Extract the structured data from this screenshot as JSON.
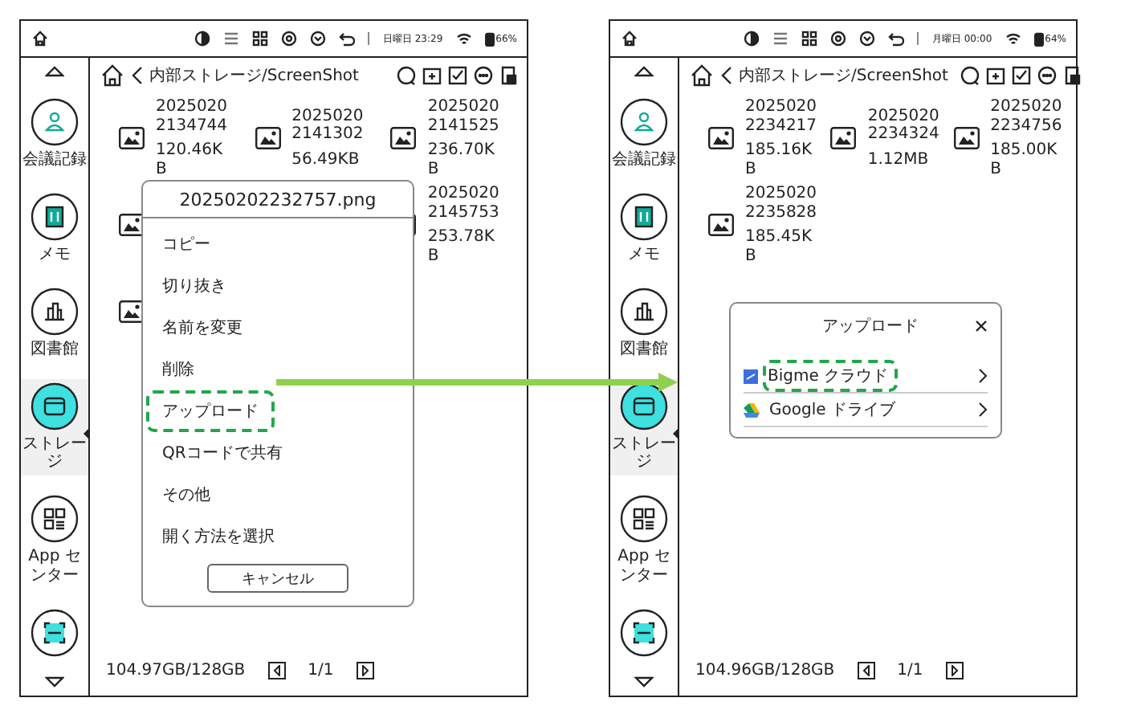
{
  "screens": [
    {
      "status_bar": {
        "day_time": "日曜日 23:29",
        "battery": "66%"
      },
      "sidebar": {
        "items": [
          {
            "kind": "meeting",
            "label": "会議記録",
            "selected": false
          },
          {
            "kind": "memo",
            "label": "メモ",
            "selected": false
          },
          {
            "kind": "library",
            "label": "図書館",
            "selected": false
          },
          {
            "kind": "storage",
            "label": "ストレージ",
            "selected": true
          },
          {
            "kind": "apps",
            "label": "App センター",
            "selected": false
          },
          {
            "kind": "scan",
            "selected": false
          }
        ]
      },
      "path": "内部ストレージ/ScreenShot",
      "files": [
        {
          "kind": "file",
          "name": "20250202134744",
          "size": "120.46KB"
        },
        {
          "kind": "file",
          "name": "20250202141302",
          "size": "56.49KB"
        },
        {
          "kind": "file",
          "name": "20250202141525",
          "size": "236.70KB"
        },
        {
          "kind": "covered"
        },
        {
          "kind": "covered"
        },
        {
          "kind": "file",
          "name": "20250202145753",
          "size": "253.78KB"
        },
        {
          "kind": "covered"
        }
      ],
      "storage": "104.97GB/128GB",
      "page": "1/1",
      "menu": {
        "title": "20250202232757.png",
        "items": [
          {
            "label": "コピー",
            "highlighted": false
          },
          {
            "label": "切り抜き",
            "highlighted": false
          },
          {
            "label": "名前を変更",
            "highlighted": false
          },
          {
            "label": "削除",
            "highlighted": false
          },
          {
            "label": "アップロード",
            "highlighted": true
          },
          {
            "label": "QRコードで共有",
            "highlighted": false
          },
          {
            "label": "その他",
            "highlighted": false
          },
          {
            "label": "開く方法を選択",
            "highlighted": false
          }
        ],
        "cancel": "キャンセル"
      }
    },
    {
      "status_bar": {
        "day_time": "月曜日 00:00",
        "battery": "64%"
      },
      "sidebar": {
        "items": [
          {
            "kind": "meeting",
            "label": "会議記録",
            "selected": false
          },
          {
            "kind": "memo",
            "label": "メモ",
            "selected": false
          },
          {
            "kind": "library",
            "label": "図書館",
            "selected": false
          },
          {
            "kind": "storage",
            "label": "ストレージ",
            "selected": true
          },
          {
            "kind": "apps",
            "label": "App センター",
            "selected": false
          },
          {
            "kind": "scan",
            "selected": false
          }
        ]
      },
      "path": "内部ストレージ/ScreenShot",
      "files": [
        {
          "kind": "file",
          "name": "20250202234217",
          "size": "185.16KB"
        },
        {
          "kind": "file",
          "name": "20250202234324",
          "size": "1.12MB"
        },
        {
          "kind": "file",
          "name": "20250202234756",
          "size": "185.00KB"
        },
        {
          "kind": "file",
          "name": "20250202235828",
          "size": "185.45KB"
        }
      ],
      "storage": "104.96GB/128GB",
      "page": "1/1",
      "dialog": {
        "title": "アップロード",
        "items": [
          {
            "kind": "bigme",
            "label": "Bigme クラウド",
            "highlighted": true
          },
          {
            "kind": "gdrive",
            "label": "Google ドライブ",
            "highlighted": false
          }
        ]
      }
    }
  ]
}
